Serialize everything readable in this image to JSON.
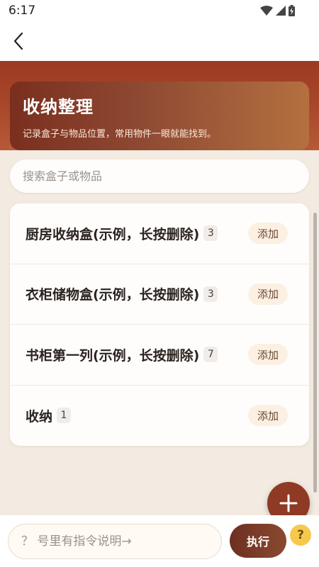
{
  "status_bar": {
    "time": "6:17",
    "icons": [
      "wifi-icon",
      "signal-icon",
      "battery-icon"
    ]
  },
  "app_bar": {
    "back_icon": "chevron-left-icon"
  },
  "hero": {
    "title": "收纳整理",
    "subtitle": "记录盒子与物品位置，常用物件一眼就能找到。"
  },
  "search": {
    "placeholder": "搜索盒子或物品",
    "value": ""
  },
  "boxes": [
    {
      "name": "厨房收纳盒(示例，长按删除)",
      "count": "3",
      "add_label": "添加"
    },
    {
      "name": "衣柜储物盒(示例，长按删除)",
      "count": "3",
      "add_label": "添加"
    },
    {
      "name": "书柜第一列(示例，长按删除)",
      "count": "7",
      "add_label": "添加"
    },
    {
      "name": "收纳",
      "count": "1",
      "add_label": "添加"
    }
  ],
  "fab": {
    "icon": "plus-icon"
  },
  "bottom": {
    "command_placeholder": "？ 号里有指令说明→",
    "command_value": "",
    "execute_label": "执行",
    "help_label": "?"
  },
  "colors": {
    "accent": "#8e3a24",
    "header": "#a9472b",
    "background": "#f3ebe1",
    "add_button": "#fbf0e2",
    "help": "#f6c94c"
  }
}
